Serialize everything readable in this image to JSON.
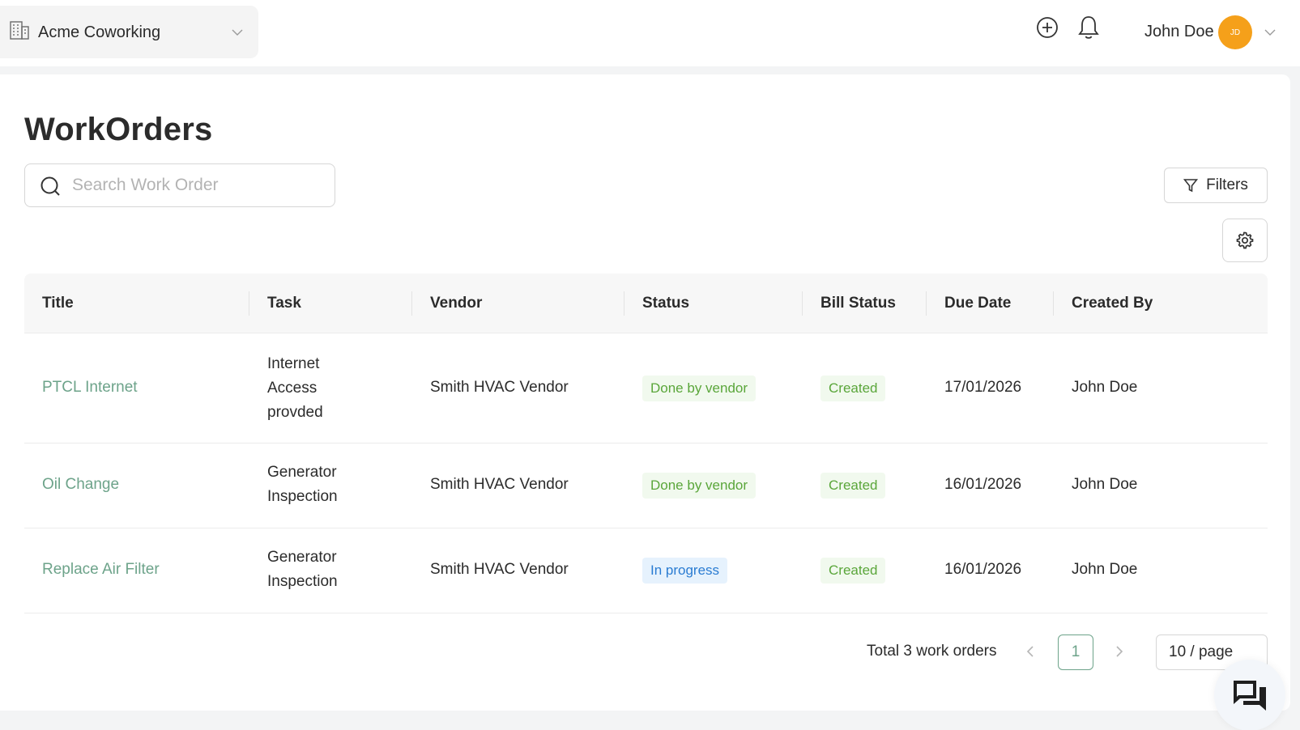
{
  "header": {
    "org_name": "Acme Coworking",
    "user_name": "John Doe",
    "avatar_initials": "JD"
  },
  "page": {
    "title": "WorkOrders",
    "search_placeholder": "Search Work Order",
    "filters_label": "Filters"
  },
  "table": {
    "columns": [
      "Title",
      "Task",
      "Vendor",
      "Status",
      "Bill Status",
      "Due Date",
      "Created By"
    ],
    "rows": [
      {
        "title": "PTCL Internet",
        "task_lines": [
          "Internet",
          "Access",
          "provded"
        ],
        "vendor": "Smith HVAC Vendor",
        "status": "Done by vendor",
        "bill_status": "Created",
        "due_date": "17/01/2026",
        "created_by": "John Doe"
      },
      {
        "title": "Oil Change",
        "task_lines": [
          "Generator",
          "Inspection"
        ],
        "vendor": "Smith HVAC Vendor",
        "status": "Done by vendor",
        "bill_status": "Created",
        "due_date": "16/01/2026",
        "created_by": "John Doe"
      },
      {
        "title": "Replace Air Filter",
        "task_lines": [
          "Generator",
          "Inspection"
        ],
        "vendor": "Smith HVAC Vendor",
        "status": "In progress",
        "bill_status": "Created",
        "due_date": "16/01/2026",
        "created_by": "John Doe"
      }
    ]
  },
  "pagination": {
    "total_label": "Total 3 work orders",
    "current_page": "1",
    "page_size_label": "10 / page"
  },
  "colors": {
    "accent_green": "#6da38a",
    "avatar_orange": "#f5a01a",
    "status_green": "#5aa63a",
    "status_blue": "#2a7cd2"
  }
}
